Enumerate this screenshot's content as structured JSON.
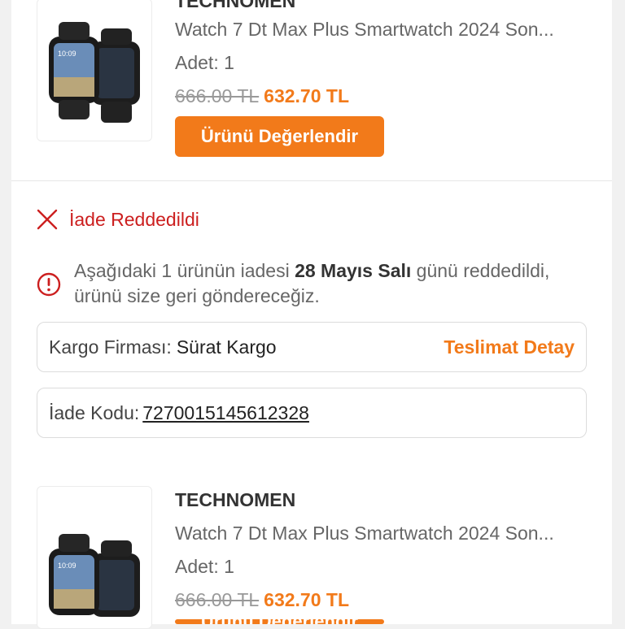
{
  "products": [
    {
      "brand": "TECHNOMEN",
      "title": "Watch 7 Dt Max Plus Smartwatch 2024 Son...",
      "quantity": "Adet: 1",
      "old_price": "666.00 TL",
      "new_price": "632.70 TL",
      "button_label": "Ürünü Değerlendir",
      "image_time": "10:09"
    },
    {
      "brand": "TECHNOMEN",
      "title": "Watch 7 Dt Max Plus Smartwatch 2024 Son...",
      "quantity": "Adet: 1",
      "old_price": "666.00 TL",
      "new_price": "632.70 TL",
      "button_label": "Ürünü Değerlendir",
      "image_time": "10:09"
    }
  ],
  "return_status": {
    "icon": "close-icon",
    "label": "İade Reddedildi",
    "color": "#cc1f1f"
  },
  "notice": {
    "icon": "info-icon",
    "prefix": "Aşağıdaki 1 ürünün iadesi",
    "date": "28 Mayıs Salı",
    "suffix": "günü reddedildi, ürünü size geri göndereceğiz."
  },
  "shipping": {
    "label": "Kargo Firması:",
    "carrier": "Sürat Kargo",
    "detail_link": "Teslimat Detay"
  },
  "return_code": {
    "label": "İade Kodu:",
    "value": "7270015145612328"
  },
  "colors": {
    "accent": "#f27a1a",
    "error": "#cc1f1f"
  }
}
